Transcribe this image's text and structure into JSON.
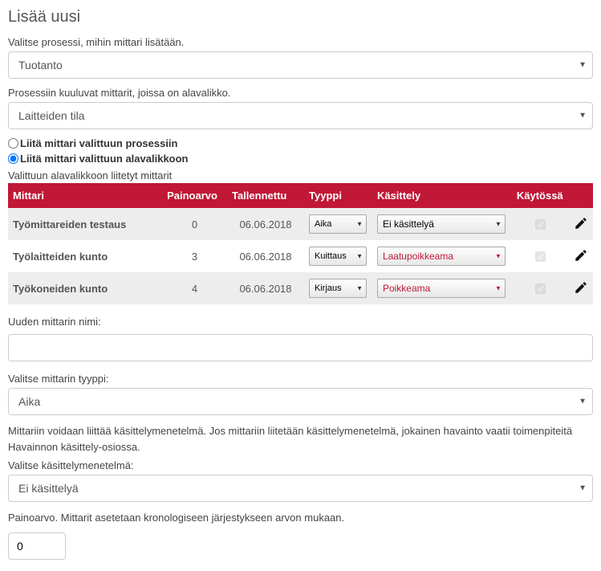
{
  "title": "Lisää uusi",
  "process_label": "Valitse prosessi, mihin mittari lisätään.",
  "process_value": "Tuotanto",
  "submenu_label": "Prosessiin kuuluvat mittarit, joissa on alavalikko.",
  "submenu_value": "Laitteiden tila",
  "attach_to_process_label": "Liitä mittari valittuun prosessiin",
  "attach_to_submenu_label": "Liitä mittari valittuun alavalikkoon",
  "attached_heading": "Valittuun alavalikkoon liitetyt mittarit",
  "table": {
    "headers": {
      "name": "Mittari",
      "weight": "Painoarvo",
      "saved": "Tallennettu",
      "type": "Tyyppi",
      "handling": "Käsittely",
      "enabled": "Käytössä"
    },
    "rows": [
      {
        "name": "Työmittareiden testaus",
        "weight": "0",
        "saved": "06.06.2018",
        "type": "Aika",
        "handling": "Ei käsittelyä",
        "handling_red": false,
        "enabled": true
      },
      {
        "name": "Työlaitteiden kunto",
        "weight": "3",
        "saved": "06.06.2018",
        "type": "Kuittaus",
        "handling": "Laatupoikkeama",
        "handling_red": true,
        "enabled": true
      },
      {
        "name": "Työkoneiden kunto",
        "weight": "4",
        "saved": "06.06.2018",
        "type": "Kirjaus",
        "handling": "Poikkeama",
        "handling_red": true,
        "enabled": true
      }
    ]
  },
  "new_name_label": "Uuden mittarin nimi:",
  "new_name_value": "",
  "type_label": "Valitse mittarin tyyppi:",
  "type_value": "Aika",
  "handling_desc": "Mittariin voidaan liittää käsittelymenetelmä. Jos mittariin liitetään käsittelymenetelmä, jokainen havainto vaatii toimenpiteitä Havainnon käsittely-osiossa.",
  "handling_label": "Valitse käsittelymenetelmä:",
  "handling_value": "Ei käsittelyä",
  "weight_label": "Painoarvo. Mittarit asetetaan kronologiseen järjestykseen arvon mukaan.",
  "weight_value": "0"
}
